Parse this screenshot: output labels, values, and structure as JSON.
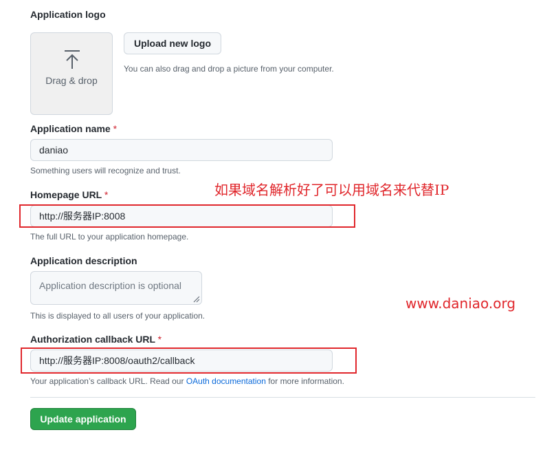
{
  "logo": {
    "label": "Application logo",
    "drop_text": "Drag & drop",
    "upload_button": "Upload new logo",
    "note": "You can also drag and drop a picture from your computer."
  },
  "name": {
    "label": "Application name",
    "required": "*",
    "value": "daniao",
    "note": "Something users will recognize and trust."
  },
  "homepage": {
    "label": "Homepage URL",
    "required": "*",
    "value": "http://服务器IP:8008",
    "note": "The full URL to your application homepage."
  },
  "description": {
    "label": "Application description",
    "placeholder": "Application description is optional",
    "note": "This is displayed to all users of your application."
  },
  "callback": {
    "label": "Authorization callback URL",
    "required": "*",
    "value": "http://服务器IP:8008/oauth2/callback",
    "note_before": "Your application’s callback URL. Read our ",
    "note_link": "OAuth documentation",
    "note_after": " for more information."
  },
  "submit": {
    "label": "Update application"
  },
  "annotations": {
    "domain_tip": "如果域名解析好了可以用域名来代替IP",
    "watermark": "www.daniao.org",
    "color": "#e0262b"
  },
  "colors": {
    "primary_green": "#2da44e",
    "required_red": "#cf222e",
    "link_blue": "#0969da"
  }
}
